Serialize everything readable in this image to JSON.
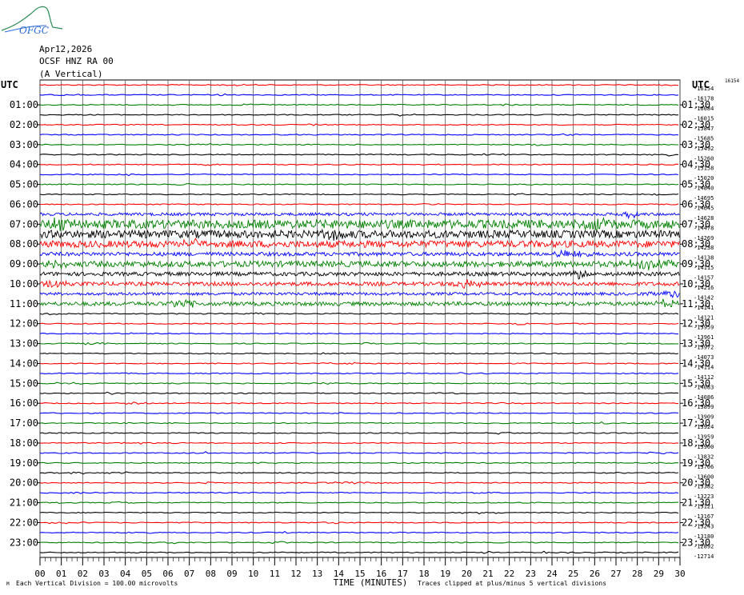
{
  "header": {
    "date": "Apr12,2026",
    "station": "OCSF HNZ RA 00",
    "component": "(A Vertical)",
    "logo_text": "OFGC"
  },
  "footer": {
    "scale_note": "Each Vertical Division =  100.00 microvolts",
    "clip_note": "Traces clipped at plus/minus 5 vertical divisions",
    "left_mark": "M"
  },
  "chart_data": {
    "type": "line",
    "title": "",
    "xlabel": "TIME (MINUTES)",
    "ylabel_left": "UTC",
    "ylabel_right": "UTC",
    "xlim": [
      0,
      30
    ],
    "x_ticks": [
      "00",
      "01",
      "02",
      "03",
      "04",
      "05",
      "06",
      "07",
      "08",
      "09",
      "10",
      "11",
      "12",
      "13",
      "14",
      "15",
      "16",
      "17",
      "18",
      "19",
      "20",
      "21",
      "22",
      "23",
      "24",
      "25",
      "26",
      "27",
      "28",
      "29",
      "30"
    ],
    "grid": true,
    "trace_colors": [
      "#ff0000",
      "#0000ff",
      "#008000",
      "#000000"
    ],
    "left_hour_labels": [
      "01:00",
      "02:00",
      "03:00",
      "04:00",
      "05:00",
      "06:00",
      "07:00",
      "08:00",
      "09:00",
      "10:00",
      "11:00",
      "12:00",
      "13:00",
      "14:00",
      "15:00",
      "16:00",
      "17:00",
      "18:00",
      "19:00",
      "20:00",
      "21:00",
      "22:00",
      "23:00"
    ],
    "right_hour_labels": [
      "01:30",
      "02:30",
      "03:30",
      "04:30",
      "05:30",
      "06:30",
      "07:30",
      "08:30",
      "09:30",
      "10:30",
      "11:30",
      "12:30",
      "13:30",
      "14:30",
      "15:30",
      "16:30",
      "17:30",
      "18:30",
      "19:30",
      "20:30",
      "21:30",
      "22:30",
      "23:30"
    ],
    "right_offsets": [
      "-16154",
      "-16178",
      "-16084",
      "-16015",
      "-15847",
      "-15685",
      "-15492",
      "-15260",
      "-15158",
      "-15020",
      "-14840",
      "-14695",
      "-14645",
      "-14628",
      "-14478",
      "-14269",
      "-14238",
      "-14138",
      "-14115",
      "-14157",
      "-14216",
      "-14142",
      "-14141",
      "-14121",
      "-13959",
      "-13961",
      "-13972",
      "-14073",
      "-14114",
      "-14112",
      "-14083",
      "-14086",
      "-13899",
      "-13909",
      "-13924",
      "-13959",
      "-13900",
      "-13832",
      "-13706",
      "-13600",
      "-13382",
      "-13223",
      "-13121",
      "-13167",
      "-13243",
      "-13180",
      "-12892",
      "-12714"
    ],
    "right_top_note": "16154",
    "trace_activity": [
      1,
      1,
      1,
      1,
      1,
      1,
      1,
      1,
      1,
      1,
      1,
      1,
      1,
      3,
      9,
      8,
      7,
      4,
      6,
      4,
      4,
      3,
      4,
      1,
      1,
      1,
      1,
      1,
      1,
      1,
      1,
      1,
      1,
      1,
      1,
      1,
      1,
      1,
      1,
      1,
      1,
      1,
      1,
      1,
      1,
      1,
      1,
      1
    ]
  }
}
